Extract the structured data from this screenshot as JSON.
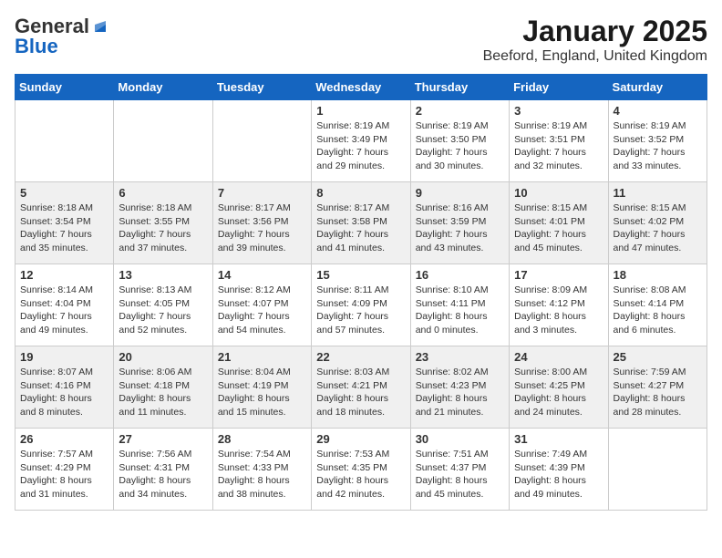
{
  "header": {
    "logo_general": "General",
    "logo_blue": "Blue",
    "month_title": "January 2025",
    "location": "Beeford, England, United Kingdom"
  },
  "days_of_week": [
    "Sunday",
    "Monday",
    "Tuesday",
    "Wednesday",
    "Thursday",
    "Friday",
    "Saturday"
  ],
  "weeks": [
    [
      {
        "day": "",
        "info": ""
      },
      {
        "day": "",
        "info": ""
      },
      {
        "day": "",
        "info": ""
      },
      {
        "day": "1",
        "info": "Sunrise: 8:19 AM\nSunset: 3:49 PM\nDaylight: 7 hours\nand 29 minutes."
      },
      {
        "day": "2",
        "info": "Sunrise: 8:19 AM\nSunset: 3:50 PM\nDaylight: 7 hours\nand 30 minutes."
      },
      {
        "day": "3",
        "info": "Sunrise: 8:19 AM\nSunset: 3:51 PM\nDaylight: 7 hours\nand 32 minutes."
      },
      {
        "day": "4",
        "info": "Sunrise: 8:19 AM\nSunset: 3:52 PM\nDaylight: 7 hours\nand 33 minutes."
      }
    ],
    [
      {
        "day": "5",
        "info": "Sunrise: 8:18 AM\nSunset: 3:54 PM\nDaylight: 7 hours\nand 35 minutes."
      },
      {
        "day": "6",
        "info": "Sunrise: 8:18 AM\nSunset: 3:55 PM\nDaylight: 7 hours\nand 37 minutes."
      },
      {
        "day": "7",
        "info": "Sunrise: 8:17 AM\nSunset: 3:56 PM\nDaylight: 7 hours\nand 39 minutes."
      },
      {
        "day": "8",
        "info": "Sunrise: 8:17 AM\nSunset: 3:58 PM\nDaylight: 7 hours\nand 41 minutes."
      },
      {
        "day": "9",
        "info": "Sunrise: 8:16 AM\nSunset: 3:59 PM\nDaylight: 7 hours\nand 43 minutes."
      },
      {
        "day": "10",
        "info": "Sunrise: 8:15 AM\nSunset: 4:01 PM\nDaylight: 7 hours\nand 45 minutes."
      },
      {
        "day": "11",
        "info": "Sunrise: 8:15 AM\nSunset: 4:02 PM\nDaylight: 7 hours\nand 47 minutes."
      }
    ],
    [
      {
        "day": "12",
        "info": "Sunrise: 8:14 AM\nSunset: 4:04 PM\nDaylight: 7 hours\nand 49 minutes."
      },
      {
        "day": "13",
        "info": "Sunrise: 8:13 AM\nSunset: 4:05 PM\nDaylight: 7 hours\nand 52 minutes."
      },
      {
        "day": "14",
        "info": "Sunrise: 8:12 AM\nSunset: 4:07 PM\nDaylight: 7 hours\nand 54 minutes."
      },
      {
        "day": "15",
        "info": "Sunrise: 8:11 AM\nSunset: 4:09 PM\nDaylight: 7 hours\nand 57 minutes."
      },
      {
        "day": "16",
        "info": "Sunrise: 8:10 AM\nSunset: 4:11 PM\nDaylight: 8 hours\nand 0 minutes."
      },
      {
        "day": "17",
        "info": "Sunrise: 8:09 AM\nSunset: 4:12 PM\nDaylight: 8 hours\nand 3 minutes."
      },
      {
        "day": "18",
        "info": "Sunrise: 8:08 AM\nSunset: 4:14 PM\nDaylight: 8 hours\nand 6 minutes."
      }
    ],
    [
      {
        "day": "19",
        "info": "Sunrise: 8:07 AM\nSunset: 4:16 PM\nDaylight: 8 hours\nand 8 minutes."
      },
      {
        "day": "20",
        "info": "Sunrise: 8:06 AM\nSunset: 4:18 PM\nDaylight: 8 hours\nand 11 minutes."
      },
      {
        "day": "21",
        "info": "Sunrise: 8:04 AM\nSunset: 4:19 PM\nDaylight: 8 hours\nand 15 minutes."
      },
      {
        "day": "22",
        "info": "Sunrise: 8:03 AM\nSunset: 4:21 PM\nDaylight: 8 hours\nand 18 minutes."
      },
      {
        "day": "23",
        "info": "Sunrise: 8:02 AM\nSunset: 4:23 PM\nDaylight: 8 hours\nand 21 minutes."
      },
      {
        "day": "24",
        "info": "Sunrise: 8:00 AM\nSunset: 4:25 PM\nDaylight: 8 hours\nand 24 minutes."
      },
      {
        "day": "25",
        "info": "Sunrise: 7:59 AM\nSunset: 4:27 PM\nDaylight: 8 hours\nand 28 minutes."
      }
    ],
    [
      {
        "day": "26",
        "info": "Sunrise: 7:57 AM\nSunset: 4:29 PM\nDaylight: 8 hours\nand 31 minutes."
      },
      {
        "day": "27",
        "info": "Sunrise: 7:56 AM\nSunset: 4:31 PM\nDaylight: 8 hours\nand 34 minutes."
      },
      {
        "day": "28",
        "info": "Sunrise: 7:54 AM\nSunset: 4:33 PM\nDaylight: 8 hours\nand 38 minutes."
      },
      {
        "day": "29",
        "info": "Sunrise: 7:53 AM\nSunset: 4:35 PM\nDaylight: 8 hours\nand 42 minutes."
      },
      {
        "day": "30",
        "info": "Sunrise: 7:51 AM\nSunset: 4:37 PM\nDaylight: 8 hours\nand 45 minutes."
      },
      {
        "day": "31",
        "info": "Sunrise: 7:49 AM\nSunset: 4:39 PM\nDaylight: 8 hours\nand 49 minutes."
      },
      {
        "day": "",
        "info": ""
      }
    ]
  ]
}
